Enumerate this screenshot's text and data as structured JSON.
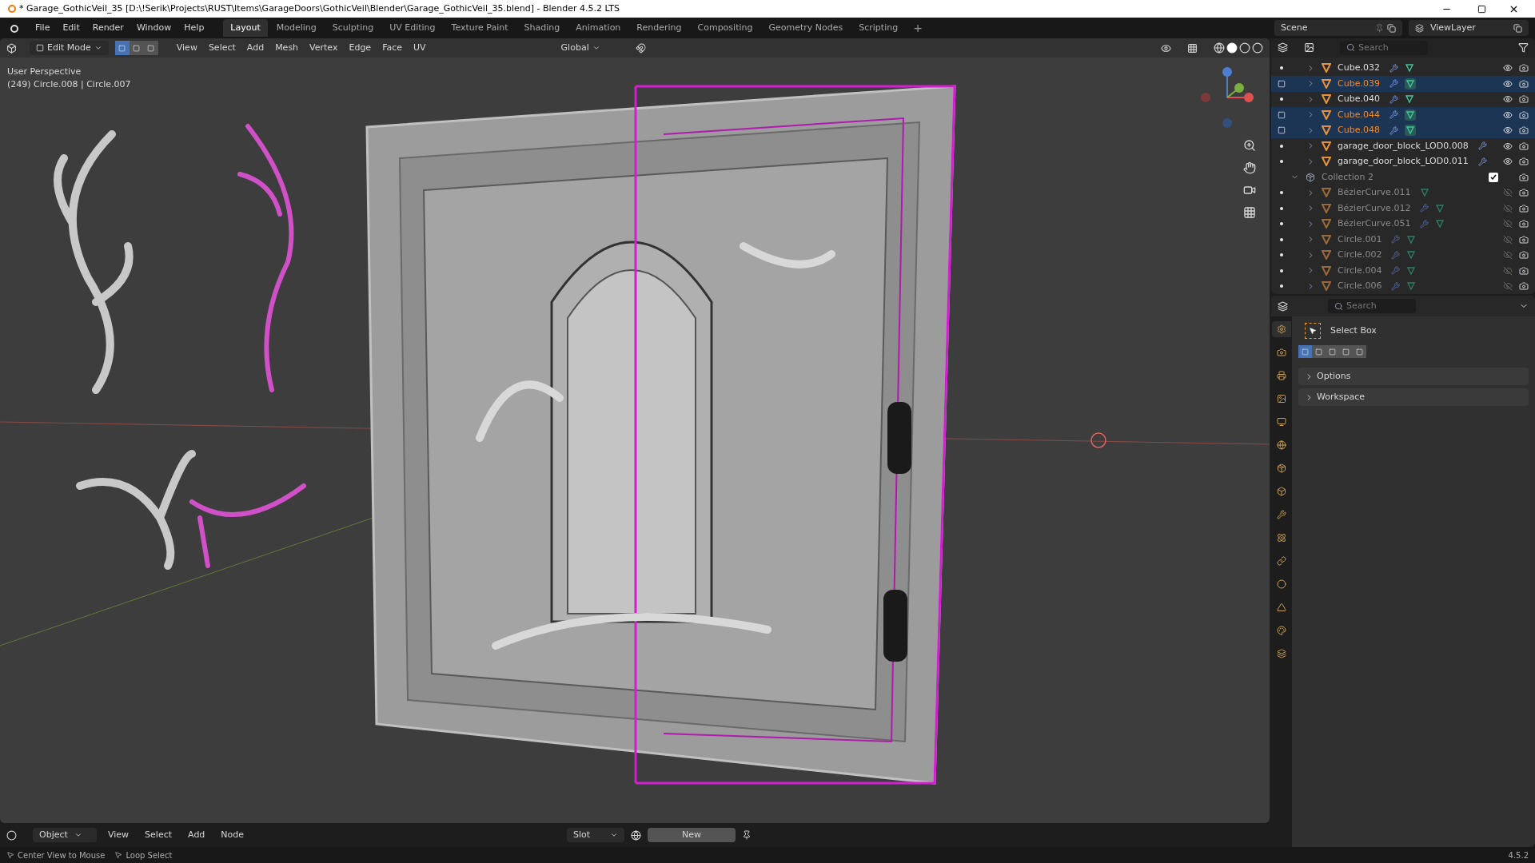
{
  "window": {
    "title": "* Garage_GothicVeil_35 [D:\\!Serik\\Projects\\RUST\\Items\\GarageDoors\\GothicVeil\\Blender\\Garage_GothicVeil_35.blend] - Blender 4.5.2 LTS"
  },
  "menu": [
    "File",
    "Edit",
    "Render",
    "Window",
    "Help"
  ],
  "workspaces": [
    {
      "label": "Layout",
      "selected": true
    },
    {
      "label": "Modeling",
      "selected": false
    },
    {
      "label": "Sculpting",
      "selected": false
    },
    {
      "label": "UV Editing",
      "selected": false
    },
    {
      "label": "Texture Paint",
      "selected": false
    },
    {
      "label": "Shading",
      "selected": false
    },
    {
      "label": "Animation",
      "selected": false
    },
    {
      "label": "Rendering",
      "selected": false
    },
    {
      "label": "Compositing",
      "selected": false
    },
    {
      "label": "Geometry Nodes",
      "selected": false
    },
    {
      "label": "Scripting",
      "selected": false
    }
  ],
  "add_workspace": "+",
  "scene": "Scene",
  "view_layer": "ViewLayer",
  "viewport_header": {
    "mode": "Edit Mode",
    "select_modes": [
      {
        "selected": true
      },
      {
        "selected": false
      },
      {
        "selected": false
      }
    ],
    "menus": [
      "View",
      "Select",
      "Add",
      "Mesh",
      "Vertex",
      "Edge",
      "Face",
      "UV"
    ],
    "orientation": "Global"
  },
  "viewport": {
    "view_name": "User Perspective",
    "object_info": "(249) Circle.008 | Circle.007"
  },
  "outliner": {
    "search_placeholder": "Search",
    "items": [
      {
        "name": "Cube.032",
        "selected": false,
        "modifier": true,
        "mesh_data": true
      },
      {
        "name": "Cube.039",
        "selected": true,
        "modifier": true,
        "mesh_data": true
      },
      {
        "name": "Cube.040",
        "selected": false,
        "modifier": true,
        "mesh_data": true
      },
      {
        "name": "Cube.044",
        "selected": true,
        "modifier": true,
        "mesh_data": true
      },
      {
        "name": "Cube.048",
        "selected": true,
        "modifier": true,
        "mesh_data": true
      },
      {
        "name": "garage_door_block_LOD0.008",
        "selected": false,
        "modifier": true,
        "mesh_data": false
      },
      {
        "name": "garage_door_block_LOD0.011",
        "selected": false,
        "modifier": true,
        "mesh_data": false
      }
    ],
    "collection": {
      "name": "Collection 2",
      "checked": true,
      "expanded": true,
      "items": [
        {
          "name": "BézierCurve.011",
          "hidden": true,
          "modifier": false,
          "mesh_data": true
        },
        {
          "name": "BézierCurve.012",
          "hidden": true,
          "modifier": true,
          "mesh_data": true
        },
        {
          "name": "BézierCurve.051",
          "hidden": true,
          "modifier": true,
          "mesh_data": true
        },
        {
          "name": "Circle.001",
          "hidden": true,
          "modifier": true,
          "mesh_data": true
        },
        {
          "name": "Circle.002",
          "hidden": true,
          "modifier": true,
          "mesh_data": true
        },
        {
          "name": "Circle.004",
          "hidden": true,
          "modifier": true,
          "mesh_data": true
        },
        {
          "name": "Circle.006",
          "hidden": true,
          "modifier": true,
          "mesh_data": true
        }
      ]
    }
  },
  "properties": {
    "search_placeholder": "Search",
    "tool": "Select Box",
    "tabs": [
      {
        "selected": true
      },
      {
        "selected": false
      },
      {
        "selected": false
      },
      {
        "selected": false
      },
      {
        "selected": false
      },
      {
        "selected": false
      },
      {
        "selected": false
      },
      {
        "selected": false
      },
      {
        "selected": false
      },
      {
        "selected": false
      },
      {
        "selected": false
      },
      {
        "selected": false
      },
      {
        "selected": false
      },
      {
        "selected": false
      },
      {
        "selected": false
      }
    ],
    "box_modes": [
      {
        "selected": true
      },
      {
        "selected": false
      },
      {
        "selected": false
      },
      {
        "selected": false
      },
      {
        "selected": false
      }
    ],
    "panels": [
      {
        "label": "Options",
        "expanded": false
      },
      {
        "label": "Workspace",
        "expanded": false
      }
    ]
  },
  "shader_header": {
    "mode": "Object",
    "menus": [
      "View",
      "Select",
      "Add",
      "Node"
    ],
    "slot": "Slot",
    "new_button": "New"
  },
  "status_bar": {
    "hints": [
      "Center View to Mouse",
      "Loop Select"
    ],
    "version": "4.5.2"
  }
}
